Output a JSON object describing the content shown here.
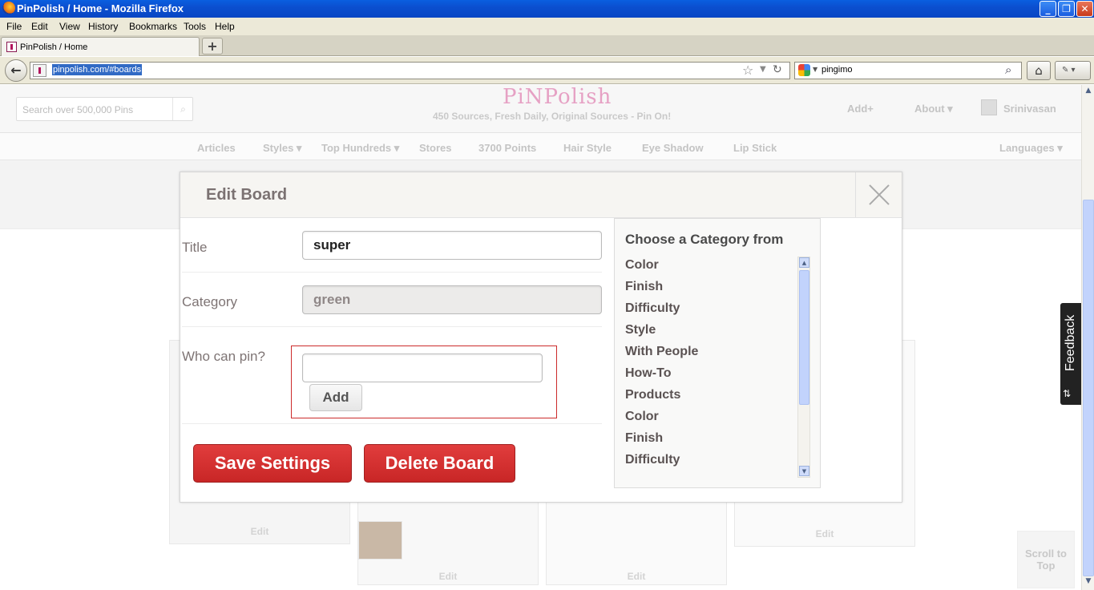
{
  "window": {
    "title": "PinPolish / Home - Mozilla Firefox",
    "minimize": "_",
    "restore": "❐",
    "close": "✕"
  },
  "menu": [
    "File",
    "Edit",
    "View",
    "History",
    "Bookmarks",
    "Tools",
    "Help"
  ],
  "tab": {
    "label": "PinPolish / Home",
    "new_tab": "+"
  },
  "nav": {
    "url": "pinpolish.com/#boards",
    "search_value": "pingimo"
  },
  "site": {
    "search_placeholder": "Search over 500,000 Pins",
    "logo": "PiNPolish",
    "tagline": "450 Sources, Fresh Daily, Original Sources - Pin On!",
    "add_link": "Add+",
    "about_link": "About ▾",
    "user_name": "Srinivasan",
    "categories": [
      "Articles",
      "Styles ▾",
      "Top Hundreds ▾",
      "Stores",
      "3700 Points",
      "Hair Style",
      "Eye Shadow",
      "Lip Stick"
    ],
    "languages": "Languages ▾",
    "edit_labels": [
      "Edit",
      "Edit",
      "Edit",
      "Edit"
    ],
    "scroll_top": "Scroll to Top",
    "feedback": "Feedback"
  },
  "modal": {
    "title": "Edit Board",
    "title_label": "Title",
    "title_value": "super",
    "category_label": "Category",
    "category_value": "green",
    "who_label": "Who can pin?",
    "who_value": "",
    "add_button": "Add",
    "save_button": "Save Settings",
    "delete_button": "Delete Board",
    "category_heading": "Choose a Category from",
    "category_options": [
      "Color",
      "Finish",
      "Difficulty",
      "Style",
      "With People",
      "How-To",
      "Products",
      "Color",
      "Finish",
      "Difficulty"
    ]
  },
  "colors": {
    "accent_red": "#d22f2f",
    "xp_titlebar": "#0a5fe0",
    "logo_pink": "#e6a1c4"
  }
}
